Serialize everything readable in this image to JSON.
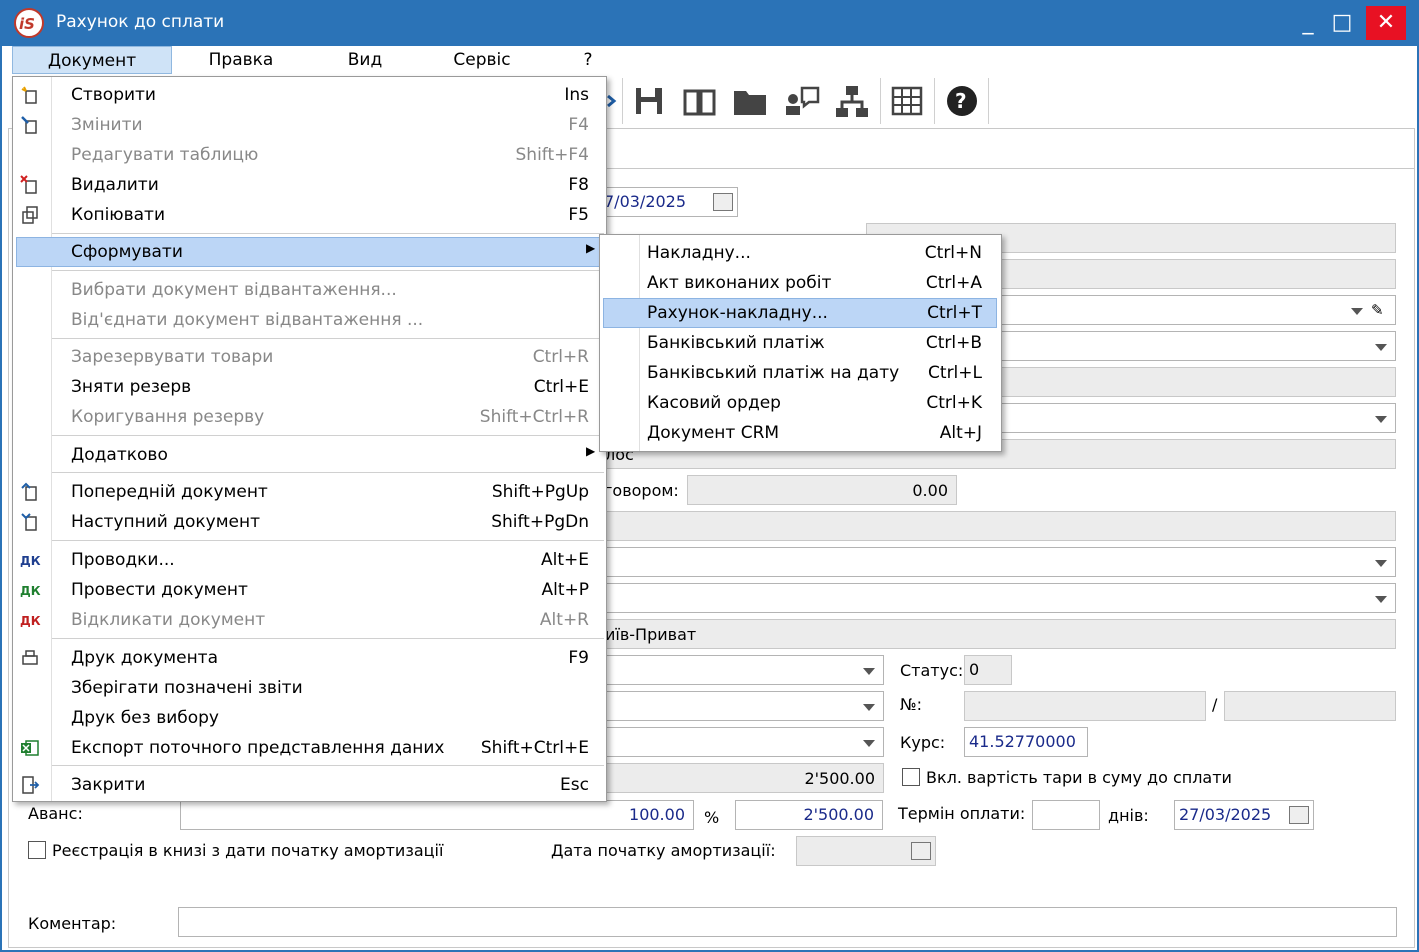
{
  "window": {
    "title": "Рахунок до сплати",
    "minimize": "_",
    "maximize": "□",
    "close": "✕"
  },
  "menubar": [
    "Документ",
    "Правка",
    "Вид",
    "Сервіс",
    "?"
  ],
  "toolbar": {
    "icons": [
      "save-icon",
      "book-icon",
      "folder-icon",
      "user-chat-icon",
      "hierarchy-icon",
      "table-icon",
      "help-icon"
    ],
    "help_glyph": "?"
  },
  "doc_menu": {
    "items": [
      {
        "label": "Створити",
        "shortcut": "Ins",
        "disabled": false,
        "icon": "create-icon"
      },
      {
        "label": "Змінити",
        "shortcut": "F4",
        "disabled": true,
        "icon": "edit-icon"
      },
      {
        "label": "Редагувати таблицю",
        "shortcut": "Shift+F4",
        "disabled": true,
        "icon": ""
      },
      {
        "label": "Видалити",
        "shortcut": "F8",
        "disabled": false,
        "icon": "delete-icon"
      },
      {
        "label": "Копіювати",
        "shortcut": "F5",
        "disabled": false,
        "icon": "copy-icon"
      },
      {
        "label": "Сформувати",
        "shortcut": "",
        "disabled": false,
        "icon": ""
      },
      {
        "label": "Вибрати документ відвантаження...",
        "shortcut": "",
        "disabled": true,
        "icon": ""
      },
      {
        "label": "Від'єднати документ відвантаження ...",
        "shortcut": "",
        "disabled": true,
        "icon": ""
      },
      {
        "label": "Зарезервувати товари",
        "shortcut": "Ctrl+R",
        "disabled": true,
        "icon": ""
      },
      {
        "label": "Зняти резерв",
        "shortcut": "Ctrl+E",
        "disabled": false,
        "icon": ""
      },
      {
        "label": "Коригування резерву",
        "shortcut": "Shift+Ctrl+R",
        "disabled": true,
        "icon": ""
      },
      {
        "label": "Додатково",
        "shortcut": "",
        "disabled": false,
        "icon": ""
      },
      {
        "label": "Попередній документ",
        "shortcut": "Shift+PgUp",
        "disabled": false,
        "icon": "prev-doc-icon"
      },
      {
        "label": "Наступний документ",
        "shortcut": "Shift+PgDn",
        "disabled": false,
        "icon": "next-doc-icon"
      },
      {
        "label": "Проводки...",
        "shortcut": "Alt+E",
        "disabled": false,
        "icon": "entries-icon"
      },
      {
        "label": "Провести документ",
        "shortcut": "Alt+P",
        "disabled": false,
        "icon": "post-doc-icon"
      },
      {
        "label": "Відкликати документ",
        "shortcut": "Alt+R",
        "disabled": true,
        "icon": "unpost-doc-icon"
      },
      {
        "label": "Друк документа",
        "shortcut": "F9",
        "disabled": false,
        "icon": "print-icon"
      },
      {
        "label": "Зберігати позначені звіти",
        "shortcut": "",
        "disabled": false,
        "icon": ""
      },
      {
        "label": "Друк без вибору",
        "shortcut": "",
        "disabled": false,
        "icon": ""
      },
      {
        "label": "Експорт поточного представлення даних",
        "shortcut": "Shift+Ctrl+E",
        "disabled": false,
        "icon": "excel-icon"
      },
      {
        "label": "Закрити",
        "shortcut": "Esc",
        "disabled": false,
        "icon": "exit-icon"
      }
    ],
    "icon_letters": {
      "dk": "ДК"
    }
  },
  "sub_menu": {
    "items": [
      {
        "label": "Накладну...",
        "shortcut": "Ctrl+N"
      },
      {
        "label": "Акт виконаних робіт",
        "shortcut": "Ctrl+A"
      },
      {
        "label": "Рахунок-накладну...",
        "shortcut": "Ctrl+T"
      },
      {
        "label": "Банківський платіж",
        "shortcut": "Ctrl+B"
      },
      {
        "label": "Банківський платіж на дату",
        "shortcut": "Ctrl+L"
      },
      {
        "label": "Касовий ордер",
        "shortcut": "Ctrl+K"
      },
      {
        "label": "Документ CRM",
        "shortcut": "Alt+J"
      }
    ]
  },
  "form": {
    "date_partial": "7/03/2025",
    "bos_partial": "лос",
    "dogovor_label_partial": "говором:",
    "dogovor_value": "0.00",
    "bank_partial": "иїв-Приват",
    "status_label": "Статус:",
    "status_value": "0",
    "number_label": "№:",
    "slash": "/",
    "rate_label": "Курс:",
    "rate_value": "41.52770000",
    "amount_value": "2'500.00",
    "tara_checkbox_label": "Вкл. вартість тари в суму до сплати",
    "avans_label": "Аванс:",
    "avans_percent_value": "100.00",
    "percent_sign": "%",
    "avans_amount": "2'500.00",
    "term_label": "Термін оплати:",
    "days_label": "днів:",
    "term_date": "27/03/2025",
    "registry_checkbox_label": "Реєстрація в книзі з дати початку амортизації",
    "amort_date_label": "Дата початку амортизації:",
    "comment_label": "Коментар:"
  }
}
